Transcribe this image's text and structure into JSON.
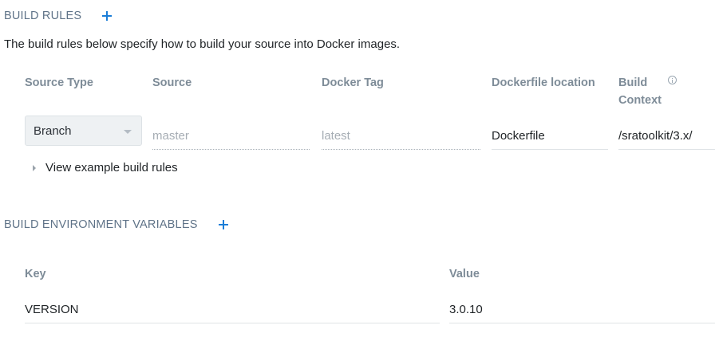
{
  "build_rules": {
    "title": "BUILD RULES",
    "description": "The build rules below specify how to build your source into Docker images.",
    "columns": {
      "source_type": "Source Type",
      "source": "Source",
      "docker_tag": "Docker Tag",
      "dockerfile_location": "Dockerfile location",
      "build_context_line1": "Build",
      "build_context_line2": "Context"
    },
    "rule": {
      "source_type": "Branch",
      "source_placeholder": "master",
      "docker_tag_placeholder": "latest",
      "dockerfile_location": "Dockerfile",
      "build_context": "/sratoolkit/3.x/"
    },
    "example_link": "View example build rules"
  },
  "env_vars": {
    "title": "BUILD ENVIRONMENT VARIABLES",
    "columns": {
      "key": "Key",
      "value": "Value"
    },
    "rows": [
      {
        "key": "VERSION",
        "value": "3.0.10"
      }
    ]
  },
  "colors": {
    "accent": "#1a7dd7",
    "section_title": "#5f7388",
    "column_header": "#7e8c98"
  },
  "icons": {
    "add": "plus-icon",
    "info": "info-icon",
    "dropdown": "chevron-down-icon",
    "expand": "caret-right-icon"
  }
}
